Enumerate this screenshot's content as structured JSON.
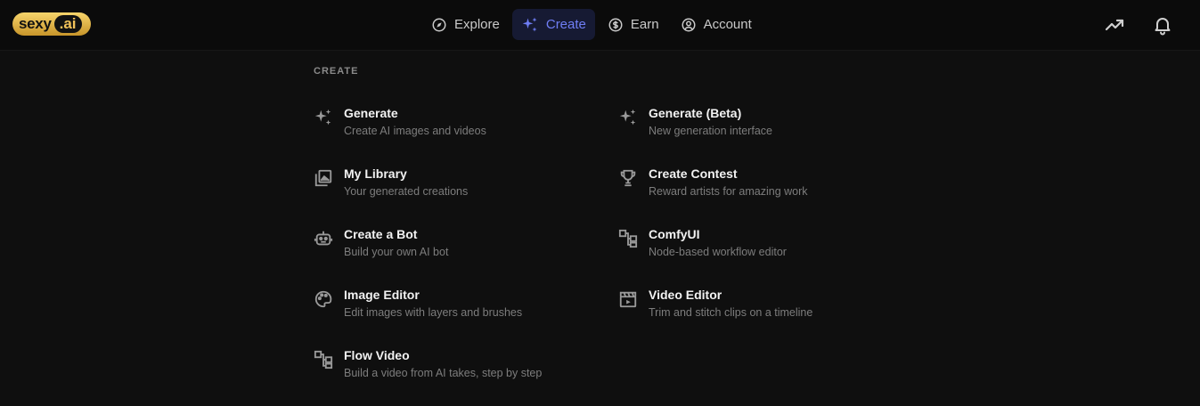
{
  "logo": {
    "word": "sexy",
    "tld": ".ai"
  },
  "nav": [
    {
      "label": "Explore",
      "icon": "compass-icon",
      "active": false
    },
    {
      "label": "Create",
      "icon": "sparkles-icon",
      "active": true
    },
    {
      "label": "Earn",
      "icon": "dollar-circle-icon",
      "active": false
    },
    {
      "label": "Account",
      "icon": "user-circle-icon",
      "active": false
    }
  ],
  "top_right": [
    {
      "icon": "trending-icon"
    },
    {
      "icon": "bell-icon"
    }
  ],
  "colors": {
    "accent": "#6f7ef5",
    "active_bg": "#161a33",
    "logo_gold": "#f1c25a"
  },
  "menu": {
    "title": "CREATE",
    "items": [
      {
        "title": "Generate",
        "desc": "Create AI images and videos",
        "icon": "sparkles-icon"
      },
      {
        "title": "Generate (Beta)",
        "desc": "New generation interface",
        "icon": "sparkles-icon"
      },
      {
        "title": "My Library",
        "desc": "Your generated creations",
        "icon": "image-library-icon"
      },
      {
        "title": "Create Contest",
        "desc": "Reward artists for amazing work",
        "icon": "trophy-icon"
      },
      {
        "title": "Create a Bot",
        "desc": "Build your own AI bot",
        "icon": "robot-icon"
      },
      {
        "title": "ComfyUI",
        "desc": "Node-based workflow editor",
        "icon": "workflow-icon"
      },
      {
        "title": "Image Editor",
        "desc": "Edit images with layers and brushes",
        "icon": "palette-icon"
      },
      {
        "title": "Video Editor",
        "desc": "Trim and stitch clips on a timeline",
        "icon": "clapperboard-icon"
      },
      {
        "title": "Flow Video",
        "desc": "Build a video from AI takes, step by step",
        "icon": "workflow-icon"
      }
    ]
  }
}
